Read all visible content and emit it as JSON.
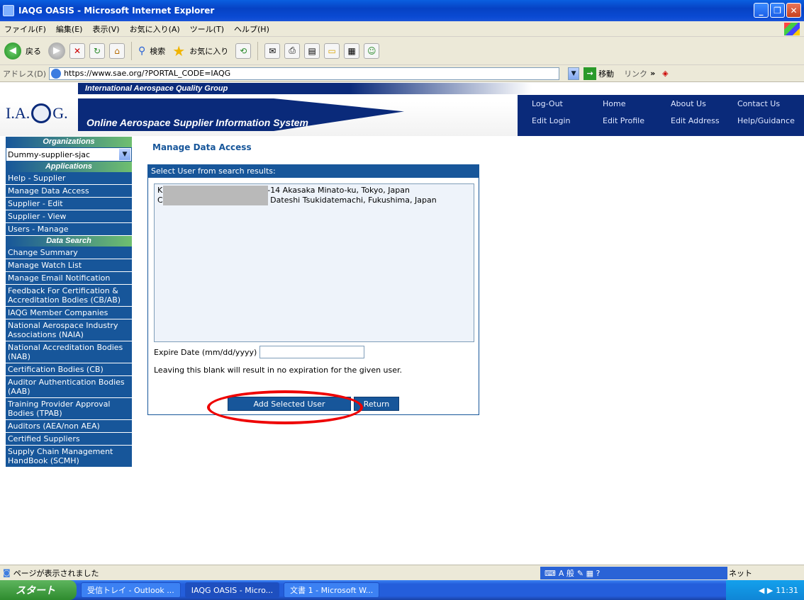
{
  "window": {
    "title": "IAQG OASIS - Microsoft Internet Explorer"
  },
  "menu": [
    "ファイル(F)",
    "編集(E)",
    "表示(V)",
    "お気に入り(A)",
    "ツール(T)",
    "ヘルプ(H)"
  ],
  "toolbar": {
    "back_label": "戻る",
    "search_label": "検索",
    "favorites_label": "お気に入り"
  },
  "address": {
    "label": "アドレス(D)",
    "url": "https://www.sae.org/?PORTAL_CODE=IAQG",
    "go_label": "移動",
    "links_label": "リンク"
  },
  "header": {
    "banner_top": "International Aerospace Quality Group",
    "banner_main": "Online Aerospace Supplier Information System",
    "logo_left": "I.A.",
    "logo_right": "G.",
    "nav": {
      "logout": "Log-Out",
      "home": "Home",
      "about": "About Us",
      "contact": "Contact Us",
      "edit_login": "Edit Login",
      "edit_profile": "Edit Profile",
      "edit_address": "Edit Address",
      "help": "Help/Guidance"
    }
  },
  "sidebar": {
    "organizations_head": "Organizations",
    "org_selected": "Dummy-supplier-sjac",
    "applications_head": "Applications",
    "applications": [
      "Help - Supplier",
      "Manage Data Access",
      "Supplier - Edit",
      "Supplier - View",
      "Users - Manage"
    ],
    "data_search_head": "Data Search",
    "data_search": [
      "Change Summary",
      "Manage Watch List",
      "Manage Email Notification",
      "Feedback For Certification & Accreditation Bodies (CB/AB)",
      "IAQG Member Companies",
      "National Aerospace Industry Associations (NAIA)",
      "National Accreditation Bodies (NAB)",
      "Certification Bodies (CB)",
      "Auditor Authentication Bodies (AAB)",
      "Training Provider Approval Bodies (TPAB)",
      "Auditors (AEA/non AEA)",
      "Certified Suppliers",
      "Supply Chain Management HandBook (SCMH)"
    ]
  },
  "main": {
    "title": "Manage Data Access",
    "panel_head": "Select User from search results:",
    "results": [
      {
        "prefix": "K",
        "suffix": "-14 Akasaka Minato-ku, Tokyo, Japan"
      },
      {
        "prefix": "C",
        "suffix": " Dateshi Tsukidatemachi, Fukushima, Japan"
      }
    ],
    "expire_label": "Expire Date (mm/dd/yyyy)",
    "expire_value": "",
    "note": "Leaving this blank will result in no expiration for the given user.",
    "add_button": "Add Selected User",
    "return_button": "Return"
  },
  "status": {
    "text": "ページが表示されました",
    "ime": "A 般",
    "zone": "ネット"
  },
  "taskbar": {
    "start": "スタート",
    "tasks": [
      "受信トレイ - Outlook ...",
      "IAQG OASIS - Micro...",
      "文書 1 - Microsoft W..."
    ],
    "clock": "11:31"
  }
}
